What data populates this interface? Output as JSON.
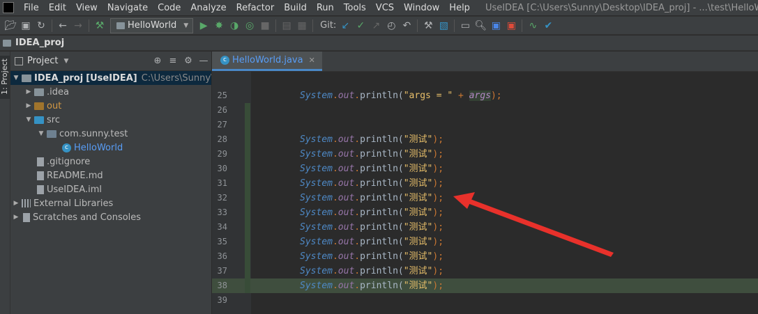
{
  "menubar": {
    "items": [
      "File",
      "Edit",
      "View",
      "Navigate",
      "Code",
      "Analyze",
      "Refactor",
      "Build",
      "Run",
      "Tools",
      "VCS",
      "Window",
      "Help"
    ],
    "window_title": "UseIDEA [C:\\Users\\Sunny\\Desktop\\IDEA_proj] - ...\\test\\HelloWorld.java"
  },
  "toolbar": {
    "run_config": "HelloWorld",
    "git_label": "Git:"
  },
  "navbar": {
    "project_name": "IDEA_proj"
  },
  "sidebar": {
    "project_tab_label": "1: Project"
  },
  "project_panel": {
    "header": "Project",
    "tree": {
      "root_name": "IDEA_proj",
      "root_module": "[UseIDEA]",
      "root_path": "C:\\Users\\Sunny\\Desktop\\IDEA_proj",
      "idea": ".idea",
      "out": "out",
      "src": "src",
      "package": "com.sunny.test",
      "class": "HelloWorld",
      "gitignore": ".gitignore",
      "readme": "README.md",
      "iml": "UseIDEA.iml",
      "ext_libs": "External Libraries",
      "scratches": "Scratches and Consoles"
    }
  },
  "editor": {
    "tab_label": "HelloWorld.java",
    "current_line": "38",
    "code": {
      "cls": "System",
      "dot": ".",
      "fld": "out",
      "mth": "println",
      "open": "(",
      "close": ");",
      "args_str": "\"args = \"",
      "plus": " + ",
      "args_param": "args",
      "test_str": "\"测试\""
    },
    "lines": [
      {
        "num": "25"
      },
      {
        "num": "26"
      },
      {
        "num": "27"
      },
      {
        "num": "28"
      },
      {
        "num": "29"
      },
      {
        "num": "30"
      },
      {
        "num": "31"
      },
      {
        "num": "32"
      },
      {
        "num": "33"
      },
      {
        "num": "34"
      },
      {
        "num": "35"
      },
      {
        "num": "36"
      },
      {
        "num": "37"
      },
      {
        "num": "38"
      },
      {
        "num": "39"
      }
    ]
  },
  "colors": {
    "background": "#2b2b2b",
    "chrome": "#3c3f41",
    "keyword_orange": "#cc7832",
    "string_yellow": "#e8bf6a",
    "class_blue": "#4e89c6",
    "field_purple": "#9876aa",
    "current_line": "#3f4e3e",
    "annotation_red": "#e8312b"
  }
}
